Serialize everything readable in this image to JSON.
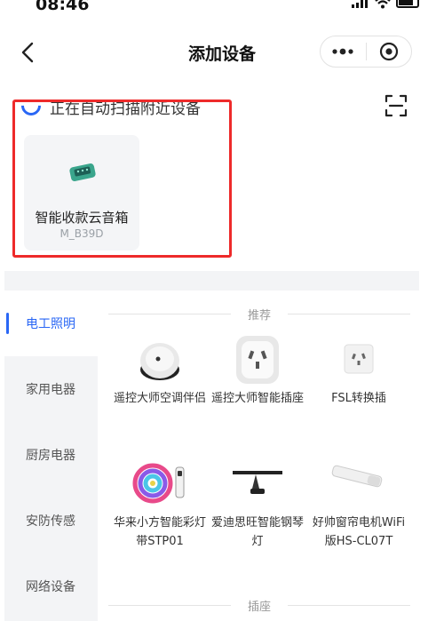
{
  "status_bar": {
    "time": "08:46"
  },
  "nav": {
    "title": "添加设备"
  },
  "scan": {
    "text": "正在自动扫描附近设备"
  },
  "found_device": {
    "name": "智能收款云音箱",
    "model": "M_B39D"
  },
  "sidebar": {
    "items": [
      {
        "label": "电工照明",
        "active": true
      },
      {
        "label": "家用电器",
        "active": false
      },
      {
        "label": "厨房电器",
        "active": false
      },
      {
        "label": "安防传感",
        "active": false
      },
      {
        "label": "网络设备",
        "active": false
      }
    ]
  },
  "sections": [
    {
      "title": "推荐",
      "products": [
        {
          "name": "遥控大师空调伴侣",
          "icon": "ac-companion-icon"
        },
        {
          "name": "遥控大师智能插座",
          "icon": "smart-plug-icon"
        },
        {
          "name": "FSL转换插",
          "icon": "adapter-plug-icon"
        },
        {
          "name": "华来小方智能彩灯带STP01",
          "icon": "rgb-light-strip-icon"
        },
        {
          "name": "爱迪思旺智能钢琴灯",
          "icon": "piano-lamp-icon"
        },
        {
          "name": "好帅窗帘电机WiFi版HS-CL07T",
          "icon": "curtain-motor-icon"
        }
      ]
    },
    {
      "title": "插座"
    }
  ],
  "colors": {
    "accent": "#2a67f5",
    "highlight": "#ee2a2a",
    "panel": "#f3f4f6"
  }
}
